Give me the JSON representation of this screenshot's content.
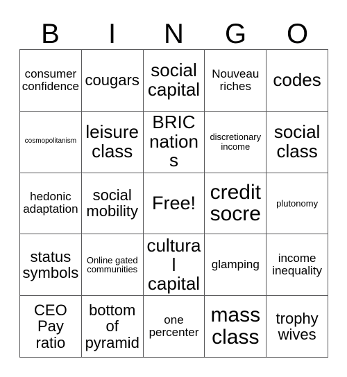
{
  "card": {
    "title": "BINGO",
    "header_letters": [
      "B",
      "I",
      "N",
      "G",
      "O"
    ],
    "grid_line_color": "#59595b",
    "text_color": "#000000",
    "background_color": "#ffffff",
    "rows": 5,
    "columns": 5,
    "free_space": "Free!",
    "cells": [
      [
        {
          "text": "consumer confidence",
          "size": "sm"
        },
        {
          "text": "cougars",
          "size": "md"
        },
        {
          "text": "social capital",
          "size": "lg"
        },
        {
          "text": "Nouveau riches",
          "size": "sm"
        },
        {
          "text": "codes",
          "size": "lg"
        }
      ],
      [
        {
          "text": "cosmopolitanism",
          "size": "xxs"
        },
        {
          "text": "leisure class",
          "size": "lg"
        },
        {
          "text": "BRIC nations",
          "size": "lg"
        },
        {
          "text": "discretionary income",
          "size": "xs"
        },
        {
          "text": "social class",
          "size": "lg"
        }
      ],
      [
        {
          "text": "hedonic adaptation",
          "size": "sm"
        },
        {
          "text": "social mobility",
          "size": "md"
        },
        {
          "text": "Free!",
          "size": "free"
        },
        {
          "text": "credit socre",
          "size": "xl"
        },
        {
          "text": "plutonomy",
          "size": "xs"
        }
      ],
      [
        {
          "text": "status symbols",
          "size": "md"
        },
        {
          "text": "Online gated communities",
          "size": "xs"
        },
        {
          "text": "cultural capital",
          "size": "lg"
        },
        {
          "text": "glamping",
          "size": "sm"
        },
        {
          "text": "income inequality",
          "size": "sm"
        }
      ],
      [
        {
          "text": "CEO Pay ratio",
          "size": "md"
        },
        {
          "text": "bottom of pyramid",
          "size": "md"
        },
        {
          "text": "one percenter",
          "size": "sm"
        },
        {
          "text": "mass class",
          "size": "xl"
        },
        {
          "text": "trophy wives",
          "size": "md"
        }
      ]
    ]
  }
}
